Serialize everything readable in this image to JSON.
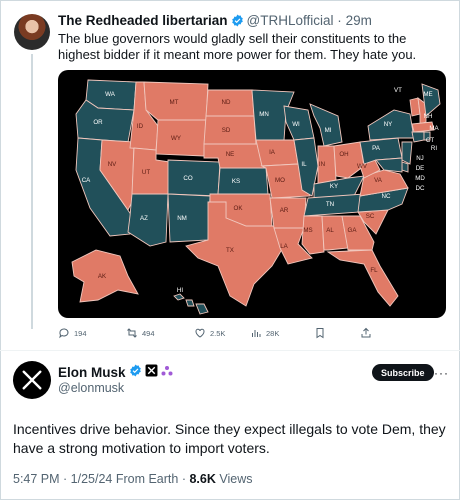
{
  "quoted_tweet": {
    "author_name": "The Redheaded libertarian",
    "author_handle": "@TRHLofficial",
    "separator": "·",
    "time_ago": "29m",
    "text": "The blue governors would gladly sell their constituents to the highest bidder if it meant more power for them. They hate you.",
    "map_labels": [
      "WA",
      "OR",
      "CA",
      "NV",
      "ID",
      "MT",
      "WY",
      "UT",
      "CO",
      "AZ",
      "NM",
      "ND",
      "SD",
      "NE",
      "KS",
      "OK",
      "TX",
      "MN",
      "IA",
      "MO",
      "AR",
      "LA",
      "WI",
      "IL",
      "MI",
      "IN",
      "OH",
      "KY",
      "TN",
      "MS",
      "AL",
      "GA",
      "FL",
      "SC",
      "NC",
      "VA",
      "WV",
      "PA",
      "NY",
      "VT",
      "ME",
      "NH",
      "MA",
      "CT",
      "RI",
      "NJ",
      "DE",
      "MD",
      "DC",
      "AK",
      "HI"
    ],
    "actions": {
      "replies": "194",
      "reposts": "494",
      "likes": "2.5K",
      "views": "28K"
    },
    "colors": {
      "red": "#e07a66",
      "blue": "#21505a"
    }
  },
  "main_tweet": {
    "author_name": "Elon Musk",
    "author_handle": "@elonmusk",
    "subscribe_label": "Subscribe",
    "more_label": "···",
    "text": "Incentives drive behavior. Since they expect illegals to vote Dem, they have a strong motivation to import voters.",
    "time": "5:47 PM · 1/25/24 From Earth ·",
    "views_count": "8.6K",
    "views_label": "Views"
  }
}
